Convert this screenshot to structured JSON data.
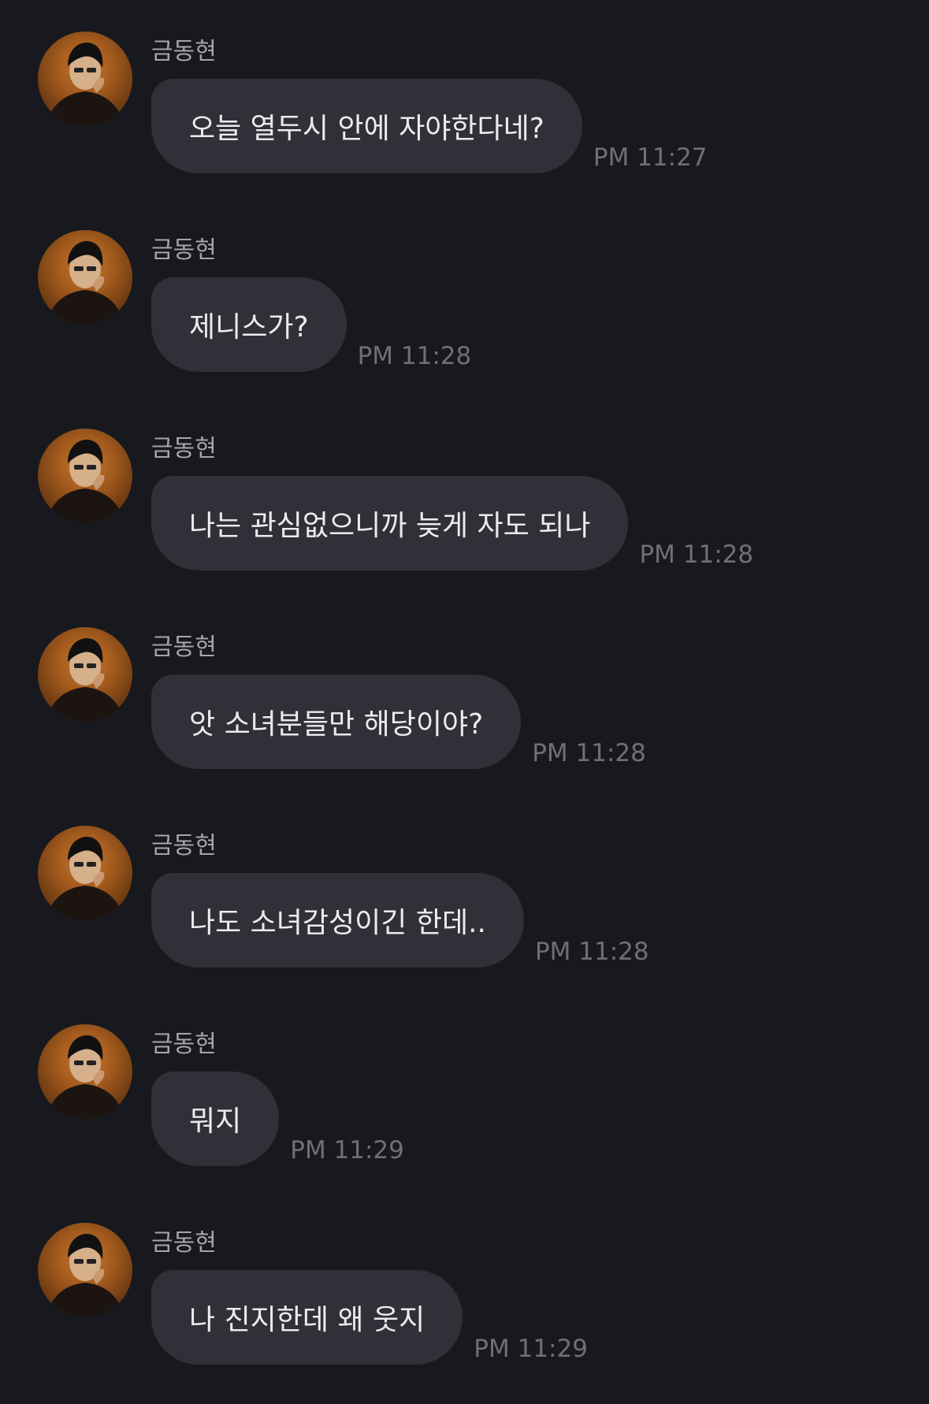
{
  "messages": [
    {
      "sender": "금동현",
      "text": "오늘 열두시 안에 자야한다네?",
      "time": "PM 11:27"
    },
    {
      "sender": "금동현",
      "text": "제니스가?",
      "time": "PM 11:28"
    },
    {
      "sender": "금동현",
      "text": "나는 관심없으니까 늦게 자도 되나",
      "time": "PM 11:28"
    },
    {
      "sender": "금동현",
      "text": "앗 소녀분들만 해당이야?",
      "time": "PM 11:28"
    },
    {
      "sender": "금동현",
      "text": "나도 소녀감성이긴 한데..",
      "time": "PM 11:28"
    },
    {
      "sender": "금동현",
      "text": "뭐지",
      "time": "PM 11:29"
    },
    {
      "sender": "금동현",
      "text": "나 진지한데 왜 웃지",
      "time": "PM 11:29"
    }
  ]
}
